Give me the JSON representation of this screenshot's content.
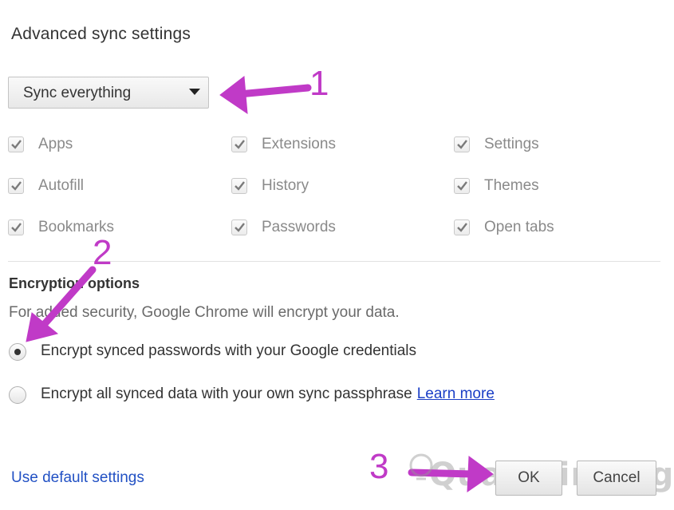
{
  "dialog": {
    "title": "Advanced sync settings",
    "sync_dropdown": {
      "selected": "Sync everything"
    },
    "sync_items": [
      {
        "label": "Apps",
        "checked": true
      },
      {
        "label": "Extensions",
        "checked": true
      },
      {
        "label": "Settings",
        "checked": true
      },
      {
        "label": "Autofill",
        "checked": true
      },
      {
        "label": "History",
        "checked": true
      },
      {
        "label": "Themes",
        "checked": true
      },
      {
        "label": "Bookmarks",
        "checked": true
      },
      {
        "label": "Passwords",
        "checked": true
      },
      {
        "label": "Open tabs",
        "checked": true
      }
    ],
    "encryption": {
      "title": "Encryption options",
      "description": "For added security, Google Chrome will encrypt your data.",
      "options": [
        {
          "label": "Encrypt synced passwords with your Google credentials",
          "selected": true
        },
        {
          "label": "Encrypt all synced data with your own sync passphrase",
          "selected": false,
          "link": "Learn more"
        }
      ]
    },
    "footer": {
      "default_link": "Use default settings",
      "ok_label": "OK",
      "cancel_label": "Cancel"
    }
  },
  "annotations": {
    "step1": "1",
    "step2": "2",
    "step3": "3",
    "color": "#c03ac7"
  },
  "watermark": {
    "text": "Quantrimang"
  }
}
